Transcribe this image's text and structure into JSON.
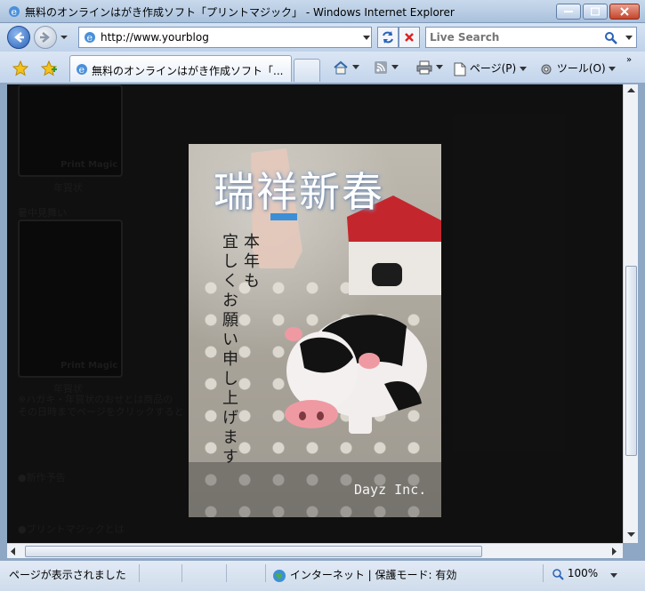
{
  "window": {
    "title": "無料のオンラインはがき作成ソフト「プリントマジック」 - Windows Internet Explorer"
  },
  "address": {
    "url": "http://www.yourblog"
  },
  "search": {
    "placeholder": "Live Search"
  },
  "tab": {
    "label": "無料のオンラインはがき作成ソフト「..."
  },
  "commands": {
    "page_label": "ページ(P)",
    "tools_label": "ツール(O)"
  },
  "background_page": {
    "thumb1_logo": "Print Magic",
    "thumb1_caption": "年賀状",
    "section_label": "暑中見舞い",
    "thumb2_logo": "Print Magic",
    "thumb2_caption": "年賀状",
    "text_line1": "※ハガキ・年賀状のおせとは商品の",
    "text_line2": "その日時までページをクリックすると",
    "text_line3": "●新作予告",
    "text_line4": "●プリントマジックとは"
  },
  "card": {
    "title": "瑞祥新春",
    "message_line1": "本年も",
    "message_line2": "宜しくお願い申し上げます",
    "credit": "Dayz Inc."
  },
  "status": {
    "text": "ページが表示されました",
    "zone": "インターネット | 保護モード: 有効",
    "zoom": "100%"
  }
}
